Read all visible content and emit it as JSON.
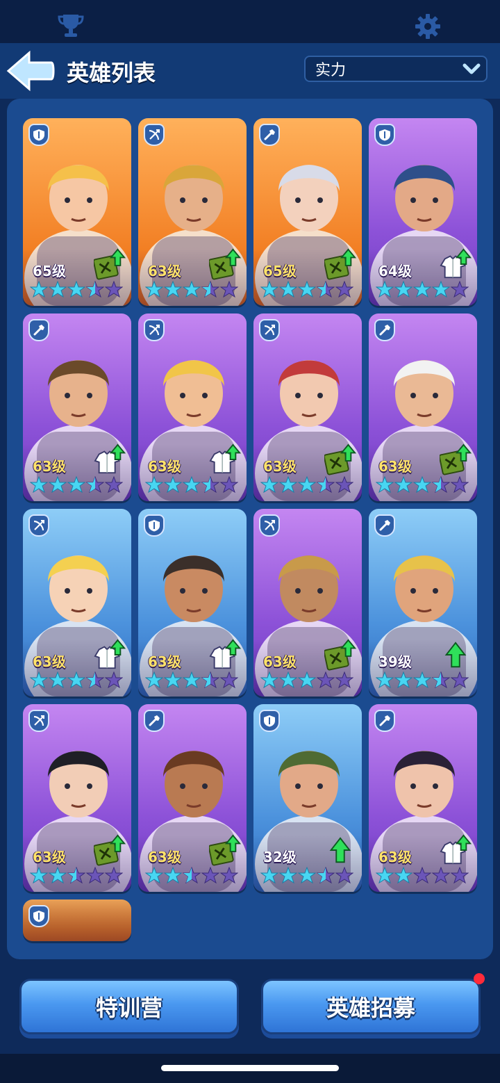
{
  "header": {
    "title": "英雄列表",
    "sort_label": "实力"
  },
  "icons": {
    "top_left": "trophy-icon",
    "top_right": "gear-icon",
    "back": "back-arrow-icon"
  },
  "heroes": [
    {
      "level": "65级",
      "color": "orange",
      "class": "shield",
      "upgrade": "manual-up",
      "stars": 3.5
    },
    {
      "level": "63级",
      "color": "orange",
      "class": "crossbow",
      "upgrade": "manual-up",
      "stars": 3.5
    },
    {
      "level": "65级",
      "color": "orange",
      "class": "wrench",
      "upgrade": "manual-up",
      "stars": 3.5
    },
    {
      "level": "64级",
      "color": "purple",
      "class": "shield",
      "upgrade": "uniform-up",
      "stars": 4
    },
    {
      "level": "63级",
      "color": "purple",
      "class": "wrench",
      "upgrade": "uniform-up",
      "stars": 3.5
    },
    {
      "level": "63级",
      "color": "purple",
      "class": "crossbow",
      "upgrade": "uniform-up",
      "stars": 3.5
    },
    {
      "level": "63级",
      "color": "purple",
      "class": "crossbow",
      "upgrade": "manual-up",
      "stars": 3.5
    },
    {
      "level": "63级",
      "color": "purple",
      "class": "wrench",
      "upgrade": "manual-up",
      "stars": 3.5
    },
    {
      "level": "63级",
      "color": "blue",
      "class": "crossbow",
      "upgrade": "uniform-up",
      "stars": 3.5
    },
    {
      "level": "63级",
      "color": "blue",
      "class": "shield",
      "upgrade": "uniform-up",
      "stars": 3.5
    },
    {
      "level": "63级",
      "color": "purple",
      "class": "crossbow",
      "upgrade": "manual-up",
      "stars": 3
    },
    {
      "level": "39级",
      "color": "blue",
      "class": "wrench",
      "upgrade": "arrow-up",
      "stars": 3.5
    },
    {
      "level": "63级",
      "color": "purple",
      "class": "crossbow",
      "upgrade": "manual-up",
      "stars": 2.5
    },
    {
      "level": "63级",
      "color": "purple",
      "class": "wrench",
      "upgrade": "manual-up",
      "stars": 2.5
    },
    {
      "level": "32级",
      "color": "blue",
      "class": "shield",
      "upgrade": "arrow-up",
      "stars": 3.5
    },
    {
      "level": "63级",
      "color": "purple",
      "class": "wrench",
      "upgrade": "uniform-up",
      "stars": 2
    },
    {
      "level": "",
      "color": "orange",
      "class": "shield",
      "upgrade": "",
      "stars": 0
    }
  ],
  "buttons": {
    "training_camp": "特训营",
    "hero_recruit": "英雄招募"
  },
  "colors": {
    "background": "#0e2a5a",
    "panel": "#1b4b90",
    "star_filled": "#48d6f2",
    "star_empty": "#6b55b8",
    "level_gold": "#ffe36a",
    "notification_dot": "#ff2b3a"
  }
}
